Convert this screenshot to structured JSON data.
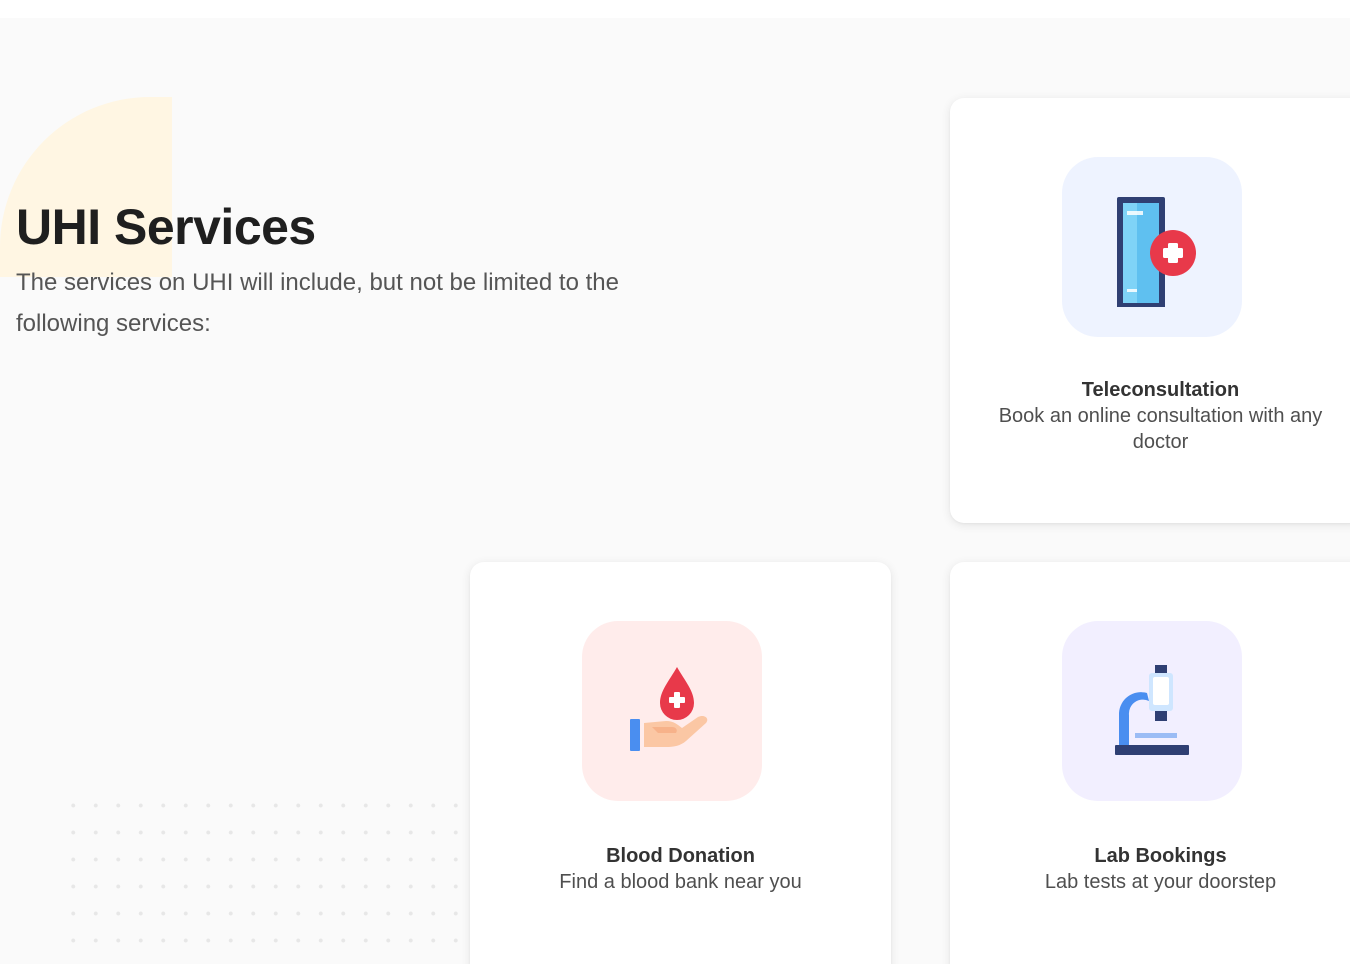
{
  "section": {
    "title": "UHI Services",
    "subtitle": "The services on UHI will include, but not be limited to the following services:"
  },
  "services": [
    {
      "title": "Teleconsultation",
      "description": "Book an online consultation with any doctor",
      "icon": "phone-medical-icon",
      "tile_color": "#eef3ff"
    },
    {
      "title": "Blood Donation",
      "description": "Find a blood bank near you",
      "icon": "blood-donation-icon",
      "tile_color": "#ffeceb"
    },
    {
      "title": "Lab Bookings",
      "description": "Lab tests at your doorstep",
      "icon": "microscope-icon",
      "tile_color": "#f2efff"
    }
  ],
  "colors": {
    "background": "#fafafa",
    "accent_red": "#e8394a",
    "accent_blue": "#4a8ef0",
    "navy": "#2f3f73",
    "blob": "#fff6e3"
  }
}
